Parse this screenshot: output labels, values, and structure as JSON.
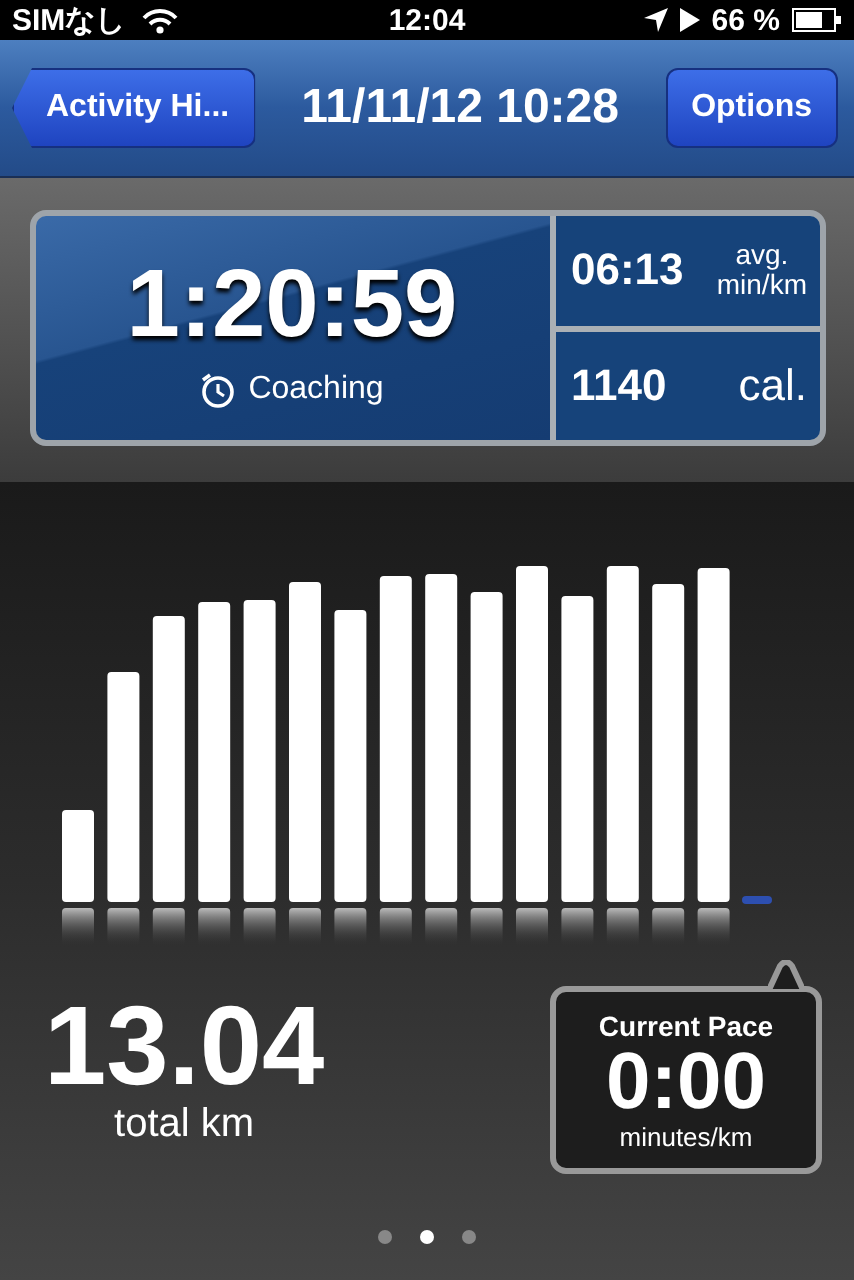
{
  "status_bar": {
    "carrier": "SIMなし",
    "time": "12:04",
    "battery": "66 %"
  },
  "nav_bar": {
    "back": "Activity Hi...",
    "title": "11/11/12 10:28",
    "action": "Options"
  },
  "stats": {
    "duration": "1:20:59",
    "coaching": "Coaching",
    "pace": "06:13",
    "pace_unit_top": "avg.",
    "pace_unit_bottom": "min/km",
    "calories": "1140",
    "calories_unit": "cal."
  },
  "distance": {
    "value": "13.04",
    "unit": "total km"
  },
  "current_pace": {
    "title": "Current Pace",
    "value": "0:00",
    "unit": "minutes/km"
  },
  "page_dots": [
    {
      "selected": false
    },
    {
      "selected": true
    },
    {
      "selected": false
    }
  ]
}
